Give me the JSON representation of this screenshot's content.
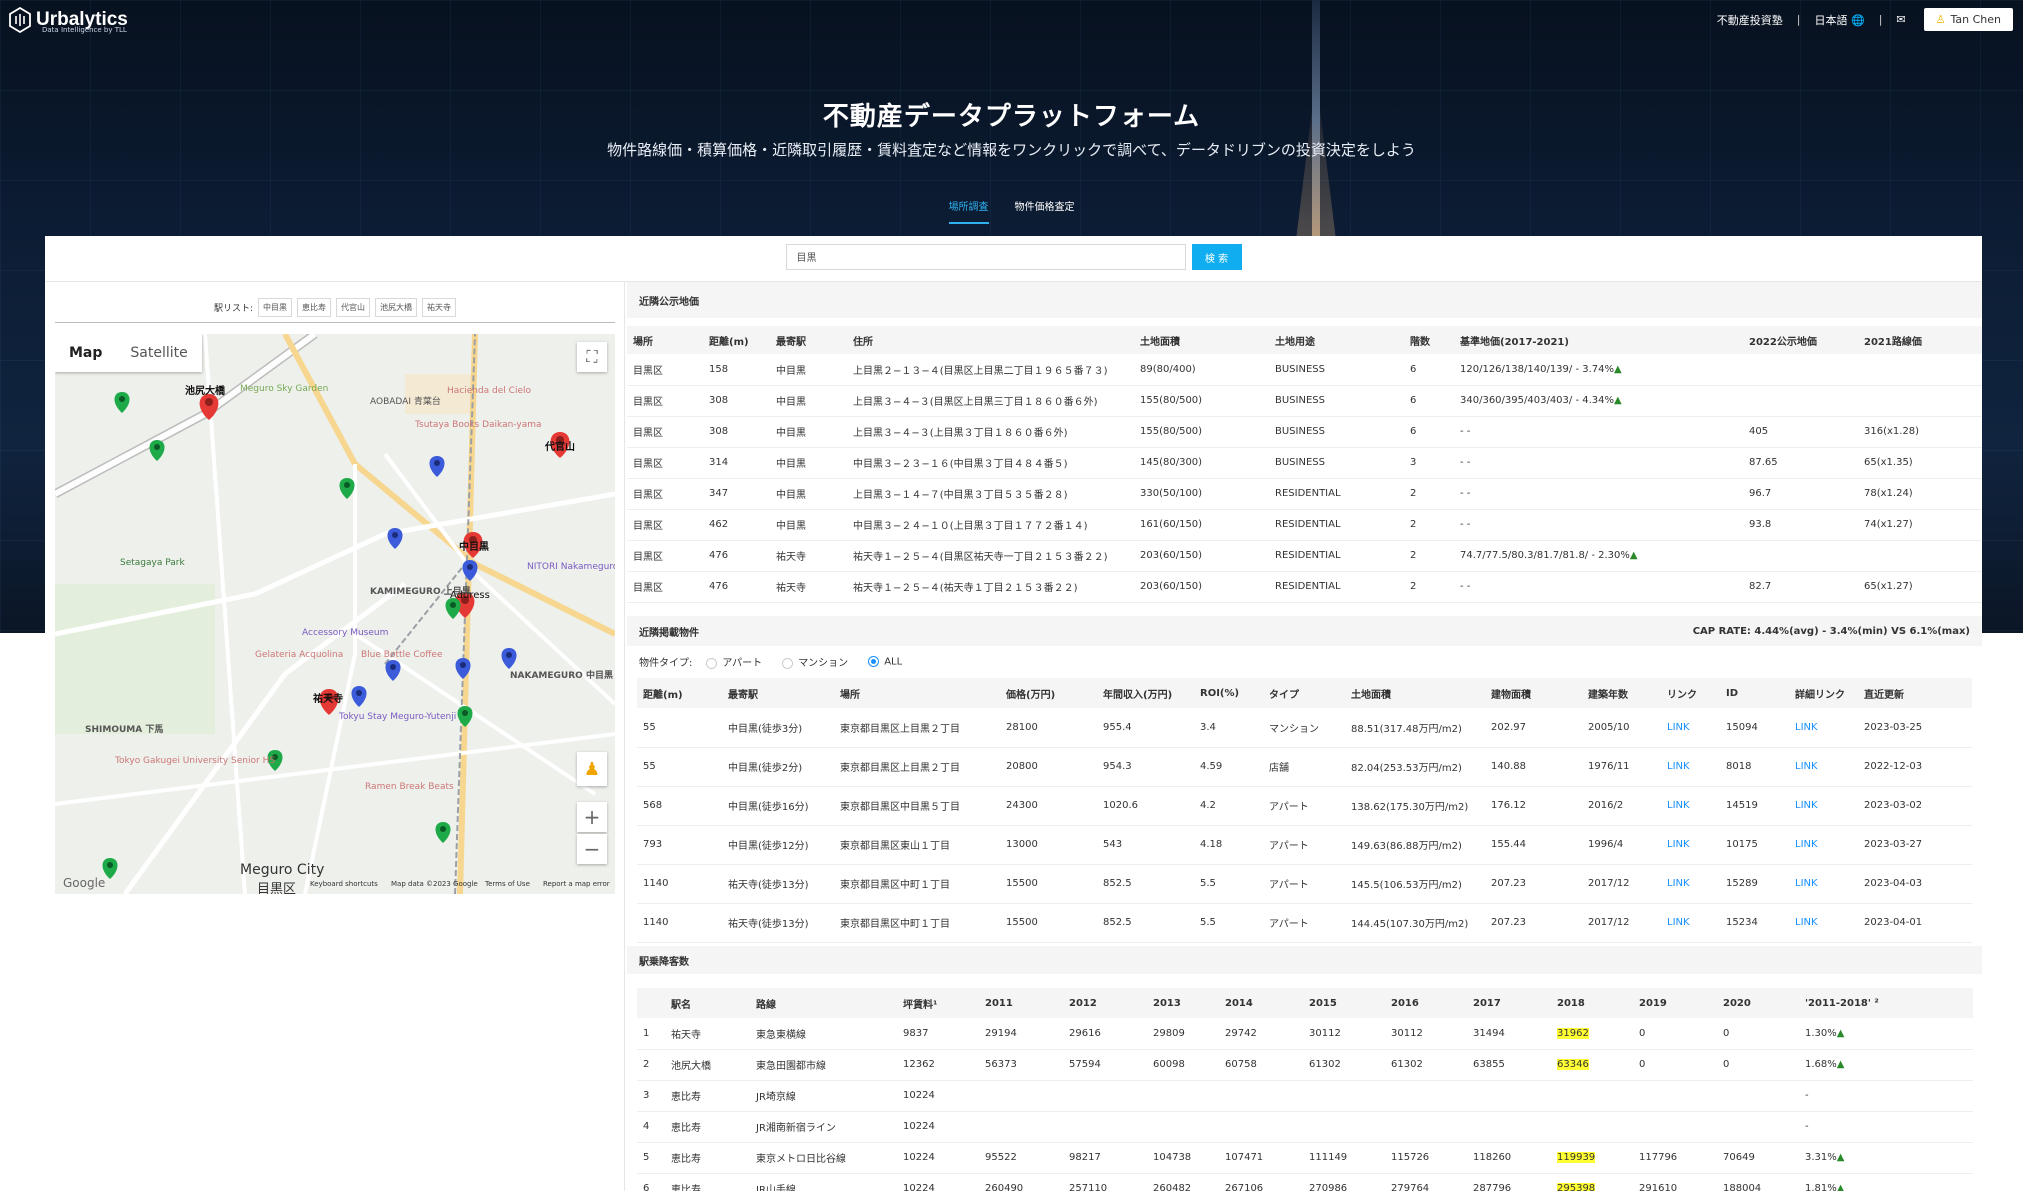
{
  "header": {
    "logo_name": "Urbalytics",
    "logo_sub": "Data Intelligence by TLL",
    "nav_invest": "不動産投資塾",
    "nav_lang": "日本語",
    "user_name": "Tan Chen"
  },
  "hero": {
    "title": "不動産データプラットフォーム",
    "subtitle": "物件路線価・積算価格・近隣取引履歴・賃料査定など情報をワンクリックで調べて、データドリブンの投資決定をしよう",
    "tabs": [
      "場所調査",
      "物件価格査定"
    ]
  },
  "search": {
    "value": "目黒",
    "button": "検 索"
  },
  "stations": {
    "label": "駅リスト:",
    "items": [
      "中目黒",
      "恵比寿",
      "代官山",
      "池尻大橋",
      "祐天寺"
    ]
  },
  "map": {
    "tab_map": "Map",
    "tab_satellite": "Satellite",
    "labels": {
      "ikejiri": "池尻大橋",
      "daikanyama": "代官山",
      "nakameguro": "中目黒",
      "yutenji": "祐天寺",
      "address": "Address",
      "meguro_sky": "Meguro Sky Garden",
      "aobadai": "AOBADAI 青葉台",
      "hacienda": "Hacienda del Cielo",
      "tsutaya": "Tsutaya Books Daikan-yama",
      "setagaya_park": "Setagaya Park",
      "kamimeguro": "KAMIMEGURO 上目黒",
      "nakameguro_area": "NAKAMEGURO 中目黒",
      "shimouma": "SHIMOUMA 下馬",
      "accessory": "Accessory Museum",
      "gelateria": "Gelateria Acquolina",
      "blue_bottle": "Blue Bottle Coffee",
      "ramen": "Ramen Break Beats",
      "tokyu": "Tokyu Stay Meguro-Yutenji",
      "tokyo_gakugei": "Tokyo Gakugei University Senior HS",
      "meguro_city": "Meguro City",
      "meguro_city_jp": "目黒区",
      "nitori": "NITORI Nakameguro Stor",
      "google": "Google",
      "keyboard": "Keyboard shortcuts",
      "mapdata": "Map data ©2023 Google",
      "terms": "Terms of Use",
      "report": "Report a map error"
    }
  },
  "land": {
    "title": "近隣公示地価",
    "headers": [
      "場所",
      "距離(m)",
      "最寄駅",
      "住所",
      "土地面積",
      "土地用途",
      "階数",
      "基準地価(2017-2021)",
      "2022公示地価",
      "2021路線価"
    ],
    "rows": [
      [
        "目黒区",
        "158",
        "中目黒",
        "上目黒２−１３−４(目黒区上目黒二丁目１９６５番７３)",
        "89(80/400)",
        "BUSINESS",
        "6",
        "120/126/138/140/139/ - 3.74%▲",
        "",
        ""
      ],
      [
        "目黒区",
        "308",
        "中目黒",
        "上目黒３−４−３(目黒区上目黒三丁目１８６０番６外)",
        "155(80/500)",
        "BUSINESS",
        "6",
        "340/360/395/403/403/ - 4.34%▲",
        "",
        ""
      ],
      [
        "目黒区",
        "308",
        "中目黒",
        "上目黒３−４−３(上目黒３丁目１８６０番６外)",
        "155(80/500)",
        "BUSINESS",
        "6",
        "- -",
        "405",
        "316(x1.28)"
      ],
      [
        "目黒区",
        "314",
        "中目黒",
        "中目黒３−２３−１６(中目黒３丁目４８４番５)",
        "145(80/300)",
        "BUSINESS",
        "3",
        "- -",
        "87.65",
        "65(x1.35)"
      ],
      [
        "目黒区",
        "347",
        "中目黒",
        "上目黒３−１４−７(中目黒３丁目５３５番２８)",
        "330(50/100)",
        "RESIDENTIAL",
        "2",
        "- -",
        "96.7",
        "78(x1.24)"
      ],
      [
        "目黒区",
        "462",
        "中目黒",
        "中目黒３−２４−１０(上目黒３丁目１７７２番１４)",
        "161(60/150)",
        "RESIDENTIAL",
        "2",
        "- -",
        "93.8",
        "74(x1.27)"
      ],
      [
        "目黒区",
        "476",
        "祐天寺",
        "祐天寺１−２５−４(目黒区祐天寺一丁目２１５３番２２)",
        "203(60/150)",
        "RESIDENTIAL",
        "2",
        "74.7/77.5/80.3/81.7/81.8/ - 2.30%▲",
        "",
        ""
      ],
      [
        "目黒区",
        "476",
        "祐天寺",
        "祐天寺１−２５−４(祐天寺１丁目２１５３番２２)",
        "203(60/150)",
        "RESIDENTIAL",
        "2",
        "- -",
        "82.7",
        "65(x1.27)"
      ]
    ]
  },
  "listings": {
    "title": "近隣掲載物件",
    "cap_rate": "CAP RATE: 4.44%(avg) - 3.4%(min) VS 6.1%(max)",
    "type_label": "物件タイプ:",
    "types": [
      "アパート",
      "マンション",
      "ALL"
    ],
    "headers": [
      "距離(m)",
      "最寄駅",
      "場所",
      "価格(万円)",
      "年間収入(万円)",
      "ROI(%)",
      "タイプ",
      "土地面積",
      "建物面積",
      "建築年数",
      "リンク",
      "ID",
      "詳細リンク",
      "直近更新"
    ],
    "rows": [
      [
        "55",
        "中目黒(徒歩3分)",
        "東京都目黒区上目黒２丁目",
        "28100",
        "955.4",
        "3.4",
        "マンション",
        "88.51(317.48万円/m2)",
        "202.97",
        "2005/10",
        "LINK",
        "15094",
        "LINK",
        "2023-03-25"
      ],
      [
        "55",
        "中目黒(徒歩2分)",
        "東京都目黒区上目黒２丁目",
        "20800",
        "954.3",
        "4.59",
        "店舗",
        "82.04(253.53万円/m2)",
        "140.88",
        "1976/11",
        "LINK",
        "8018",
        "LINK",
        "2022-12-03"
      ],
      [
        "568",
        "中目黒(徒歩16分)",
        "東京都目黒区中目黒５丁目",
        "24300",
        "1020.6",
        "4.2",
        "アパート",
        "138.62(175.30万円/m2)",
        "176.12",
        "2016/2",
        "LINK",
        "14519",
        "LINK",
        "2023-03-02"
      ],
      [
        "793",
        "中目黒(徒歩12分)",
        "東京都目黒区東山１丁目",
        "13000",
        "543",
        "4.18",
        "アパート",
        "149.63(86.88万円/m2)",
        "155.44",
        "1996/4",
        "LINK",
        "10175",
        "LINK",
        "2023-03-27"
      ],
      [
        "1140",
        "祐天寺(徒歩13分)",
        "東京都目黒区中町１丁目",
        "15500",
        "852.5",
        "5.5",
        "アパート",
        "145.5(106.53万円/m2)",
        "207.23",
        "2017/12",
        "LINK",
        "15289",
        "LINK",
        "2023-04-03"
      ],
      [
        "1140",
        "祐天寺(徒歩13分)",
        "東京都目黒区中町１丁目",
        "15500",
        "852.5",
        "5.5",
        "アパート",
        "144.45(107.30万円/m2)",
        "207.23",
        "2017/12",
        "LINK",
        "15234",
        "LINK",
        "2023-04-01"
      ]
    ]
  },
  "passengers": {
    "title": "駅乗降客数",
    "headers": [
      "",
      "駅名",
      "路線",
      "坪賃料¹",
      "2011",
      "2012",
      "2013",
      "2014",
      "2015",
      "2016",
      "2017",
      "2018",
      "2019",
      "2020",
      "'2011-2018' ²"
    ],
    "rows": [
      [
        "1",
        "祐天寺",
        "東急東横線",
        "9837",
        "29194",
        "29616",
        "29809",
        "29742",
        "30112",
        "30112",
        "31494",
        "31962",
        "0",
        "0",
        "1.30%▲"
      ],
      [
        "2",
        "池尻大橋",
        "東急田園都市線",
        "12362",
        "56373",
        "57594",
        "60098",
        "60758",
        "61302",
        "61302",
        "63855",
        "63346",
        "0",
        "0",
        "1.68%▲"
      ],
      [
        "3",
        "恵比寿",
        "JR埼京線",
        "10224",
        "",
        "",
        "",
        "",
        "",
        "",
        "",
        "",
        "",
        "",
        "-"
      ],
      [
        "4",
        "恵比寿",
        "JR湘南新宿ライン",
        "10224",
        "",
        "",
        "",
        "",
        "",
        "",
        "",
        "",
        "",
        "",
        "-"
      ],
      [
        "5",
        "恵比寿",
        "東京メトロ日比谷線",
        "10224",
        "95522",
        "98217",
        "104738",
        "107471",
        "111149",
        "115726",
        "118260",
        "119939",
        "117796",
        "70649",
        "3.31%▲"
      ],
      [
        "6",
        "恵比寿",
        "JR山手線",
        "10224",
        "260490",
        "257110",
        "260482",
        "267106",
        "270986",
        "279764",
        "287796",
        "295398",
        "291610",
        "188004",
        "1.81%▲"
      ]
    ]
  },
  "colors": {
    "accent": "#10aef0",
    "link": "#1890ff",
    "highlight": "#ffff33",
    "pin_red": "#e53935",
    "pin_green": "#1faa4a",
    "pin_blue": "#3b5bdb"
  }
}
